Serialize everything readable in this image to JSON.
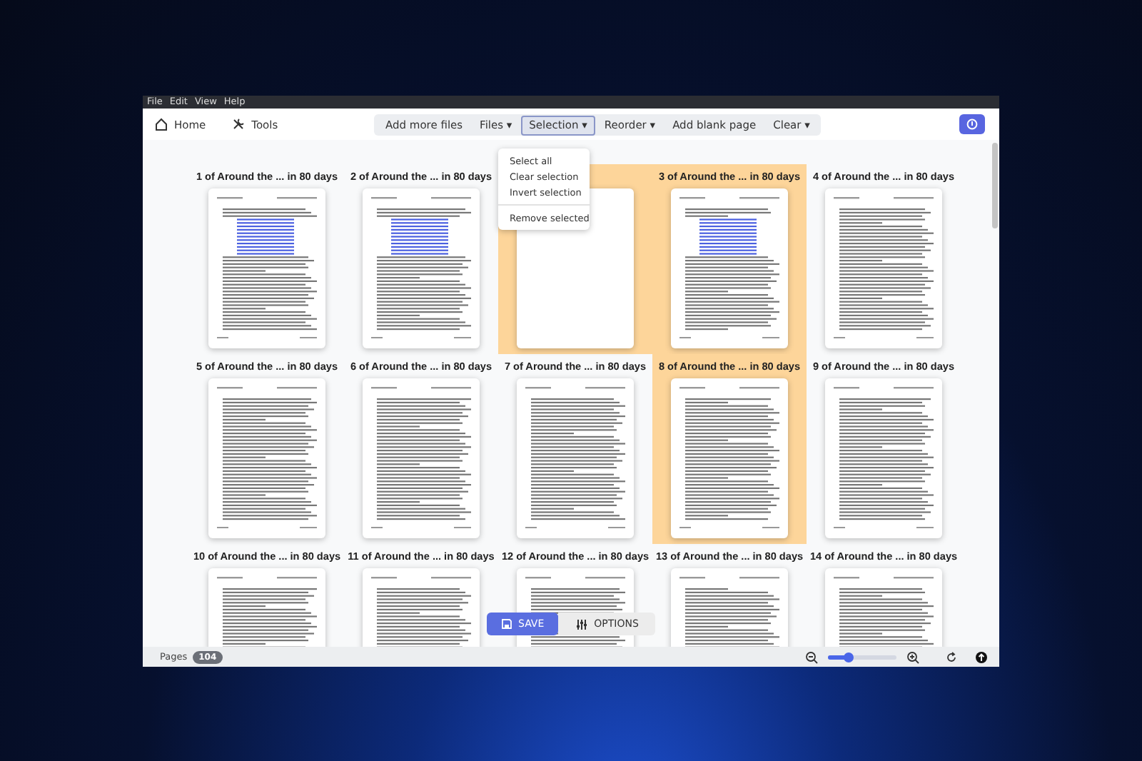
{
  "menu_bar": [
    "File",
    "Edit",
    "View",
    "Help"
  ],
  "toolbar": {
    "left": [
      {
        "label": "Home"
      },
      {
        "label": "Tools"
      }
    ],
    "actions": [
      {
        "label": "Add more files",
        "selected": false
      },
      {
        "label": "Files",
        "caret": "▾",
        "selected": false
      },
      {
        "label": "Selection",
        "caret": "▾",
        "selected": true
      },
      {
        "label": "Reorder",
        "caret": "▾",
        "selected": false
      },
      {
        "label": "Add blank page",
        "selected": false
      },
      {
        "label": "Clear",
        "caret": "▾",
        "selected": false
      }
    ]
  },
  "selection_menu": [
    {
      "label": "Select all",
      "kind": "item"
    },
    {
      "label": "Clear selection",
      "kind": "item"
    },
    {
      "label": "Invert selection",
      "kind": "item"
    },
    {
      "kind": "divider"
    },
    {
      "label": "Remove selected",
      "kind": "item"
    }
  ],
  "pages": [
    {
      "kind": "page",
      "label": "1 of Around the ... in 80 days",
      "selected": false,
      "has_links": true
    },
    {
      "kind": "page",
      "label": "2 of Around the ... in 80 days",
      "selected": false,
      "has_links": true
    },
    {
      "kind": "blank",
      "selected": true
    },
    {
      "kind": "page",
      "label": "3 of Around the ... in 80 days",
      "selected": true,
      "has_links": true
    },
    {
      "kind": "page",
      "label": "4 of Around the ... in 80 days",
      "selected": false,
      "has_links": false
    },
    {
      "kind": "page",
      "label": "5 of Around the ... in 80 days",
      "selected": false,
      "has_links": false
    },
    {
      "kind": "page",
      "label": "6 of Around the ... in 80 days",
      "selected": false,
      "has_links": false
    },
    {
      "kind": "page",
      "label": "7 of Around the ... in 80 days",
      "selected": false,
      "has_links": false
    },
    {
      "kind": "page",
      "label": "8 of Around the ... in 80 days",
      "selected": true,
      "has_links": false
    },
    {
      "kind": "page",
      "label": "9 of Around the ... in 80 days",
      "selected": false,
      "has_links": false
    },
    {
      "kind": "page",
      "label": "10 of Around the ... in 80 days",
      "selected": false,
      "has_links": false
    },
    {
      "kind": "page",
      "label": "11 of Around the ... in 80 days",
      "selected": false,
      "has_links": false
    },
    {
      "kind": "page",
      "label": "12 of Around the ... in 80 days",
      "selected": false,
      "has_links": false
    },
    {
      "kind": "page",
      "label": "13 of Around the ... in 80 days",
      "selected": false,
      "has_links": false
    },
    {
      "kind": "page",
      "label": "14 of Around the ... in 80 days",
      "selected": false,
      "has_links": false
    }
  ],
  "floating_buttons": [
    {
      "label": "SAVE",
      "kind": "primary"
    },
    {
      "label": "OPTIONS",
      "kind": "secondary"
    }
  ],
  "status_bar": {
    "pages_label": "Pages",
    "pages_count": "104",
    "zoom": {
      "level": 0.3
    }
  }
}
